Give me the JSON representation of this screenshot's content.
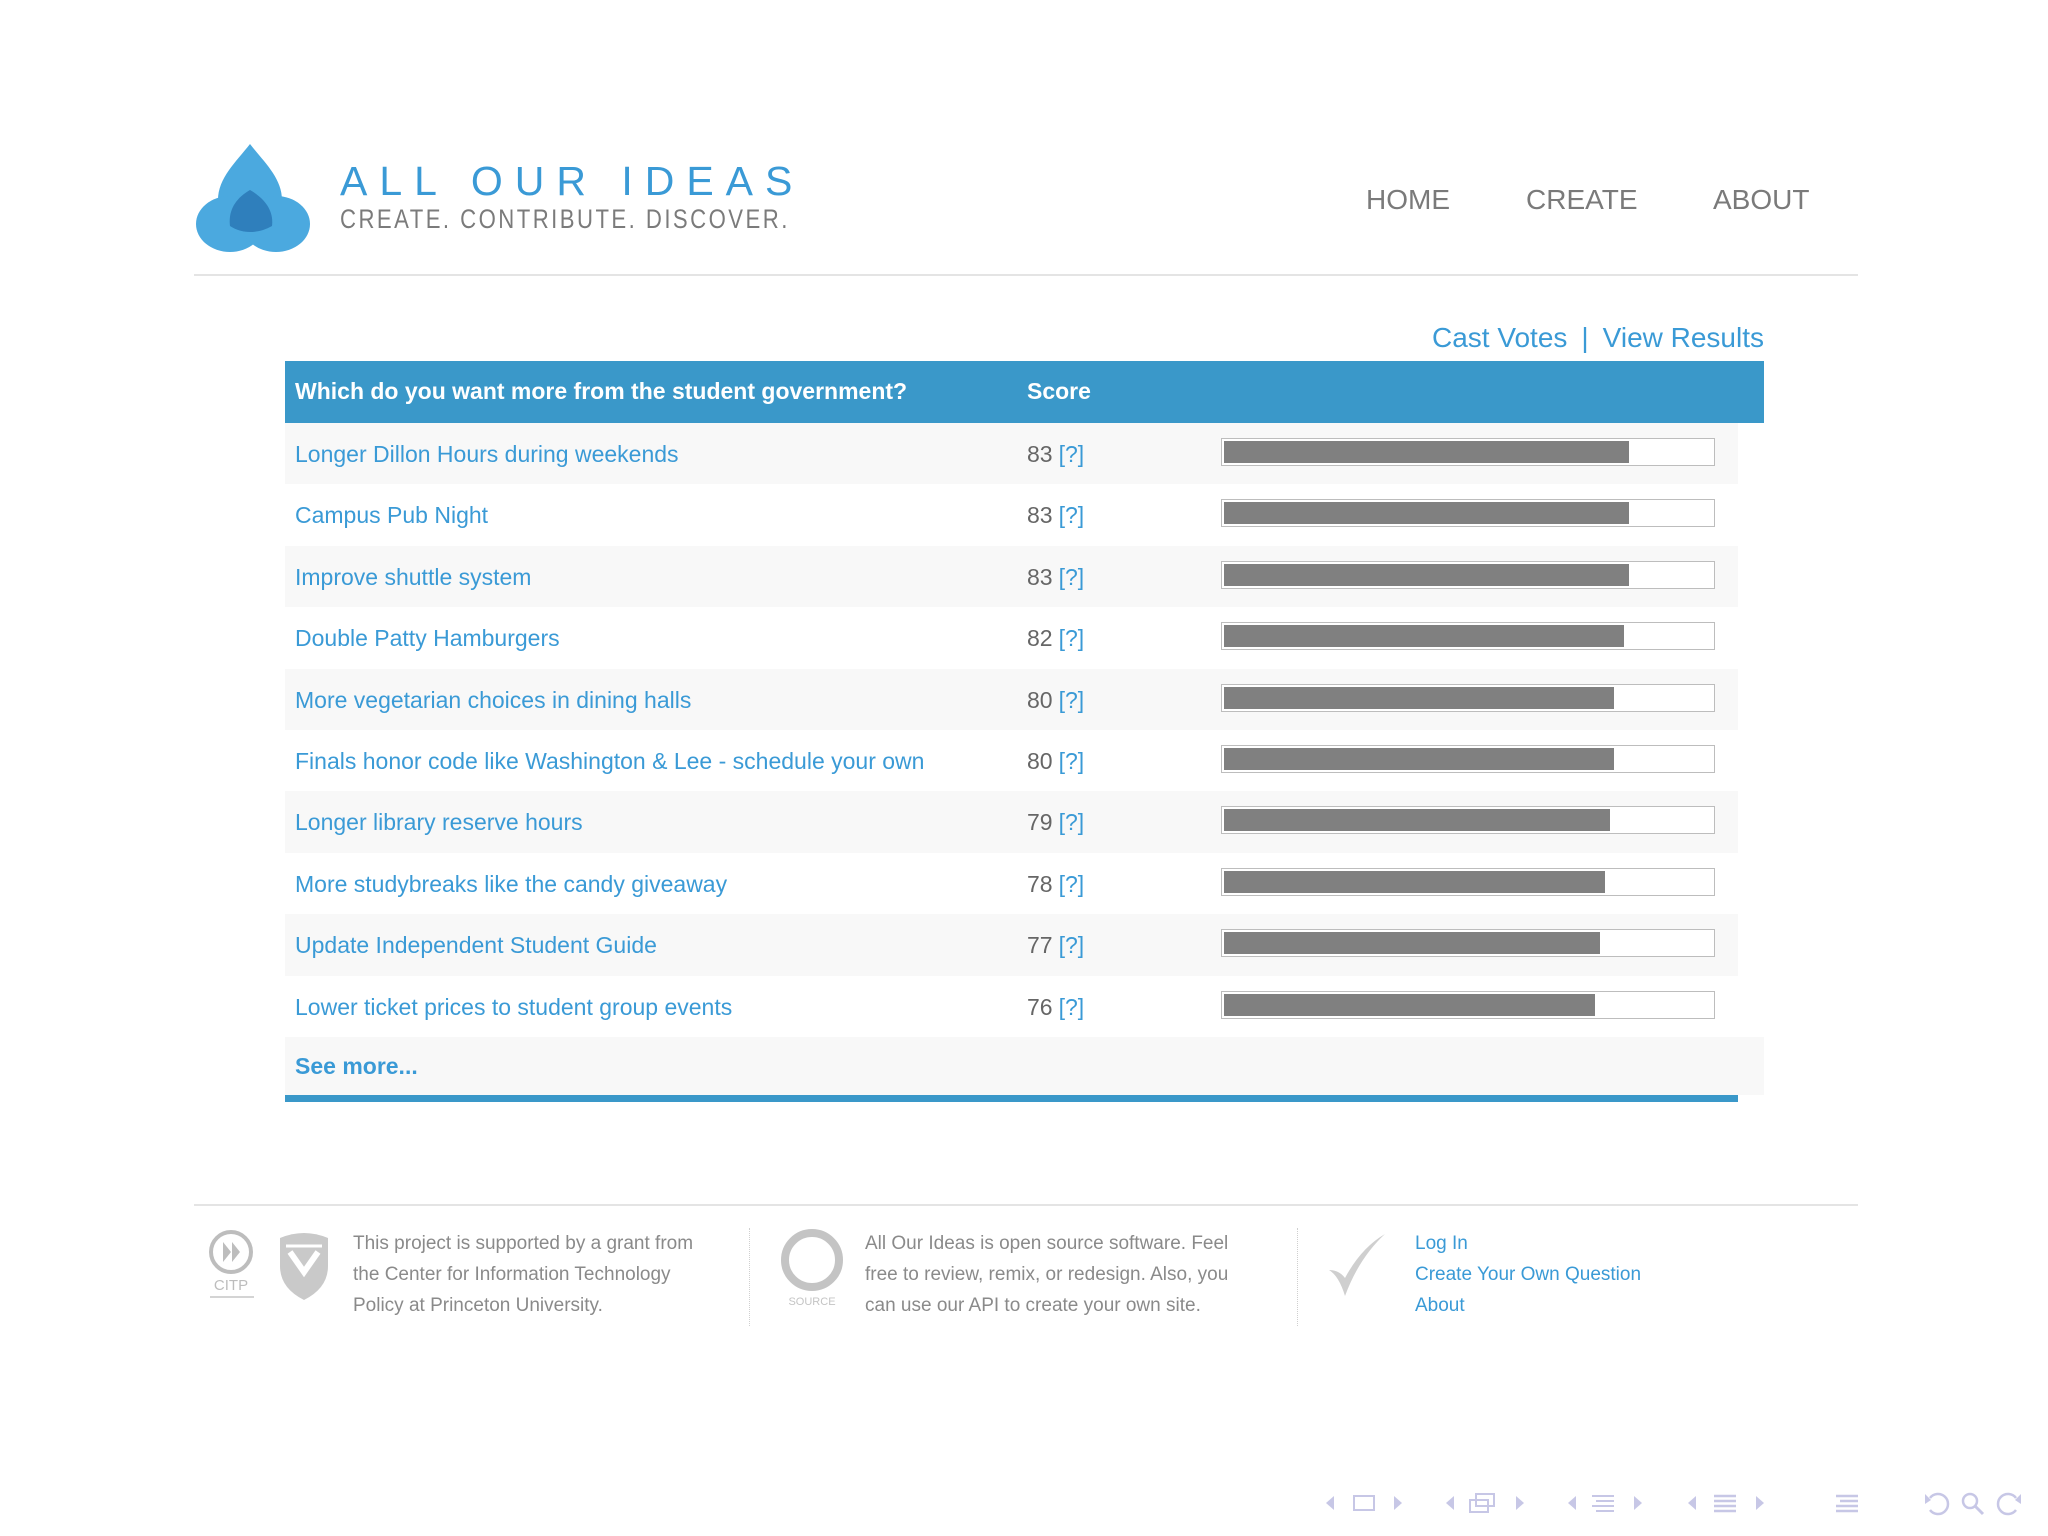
{
  "header": {
    "logo_title": "ALL OUR IDEAS",
    "logo_tagline": "CREATE. CONTRIBUTE. DISCOVER.",
    "nav": {
      "home": "HOME",
      "create": "CREATE",
      "about": "ABOUT"
    }
  },
  "result_links": {
    "cast_votes": "Cast Votes",
    "separator": "|",
    "view_results": "View Results"
  },
  "table": {
    "question": "Which do you want more from the student government?",
    "score_header": "Score",
    "help_label": "[?]",
    "rows": [
      {
        "idea": "Longer Dillon Hours during weekends",
        "score": "83"
      },
      {
        "idea": "Campus Pub Night",
        "score": "83"
      },
      {
        "idea": "Improve shuttle system",
        "score": "83"
      },
      {
        "idea": "Double Patty Hamburgers",
        "score": "82"
      },
      {
        "idea": "More vegetarian choices in dining halls",
        "score": "80"
      },
      {
        "idea": "Finals honor code like Washington & Lee - schedule your own",
        "score": "80"
      },
      {
        "idea": "Longer library reserve hours",
        "score": "79"
      },
      {
        "idea": "More studybreaks like the candy giveaway",
        "score": "78"
      },
      {
        "idea": "Update Independent Student Guide",
        "score": "77"
      },
      {
        "idea": "Lower ticket prices to student group events",
        "score": "76"
      }
    ],
    "see_more": "See more..."
  },
  "footer": {
    "citp_label": "CITP",
    "source_label": "SOURCE",
    "grant_text": "This project is supported by a grant from the Center for Information Technology Policy at Princeton University.",
    "open_source_text": "All Our Ideas is open source software. Feel free to review, remix, or redesign. Also, you can use our API to create your own site.",
    "links": {
      "log_in": "Log In",
      "create_question": "Create Your Own Question",
      "about": "About"
    }
  },
  "colors": {
    "accent": "#3a9ad6",
    "header_bar": "#3a98c9",
    "bar_fill": "#808080"
  },
  "icons": {
    "logo": "three-petal-logo-icon",
    "citp": "citp-play-icon",
    "shield": "princeton-shield-icon",
    "source": "open-source-ring-icon",
    "check": "checkmark-icon"
  }
}
